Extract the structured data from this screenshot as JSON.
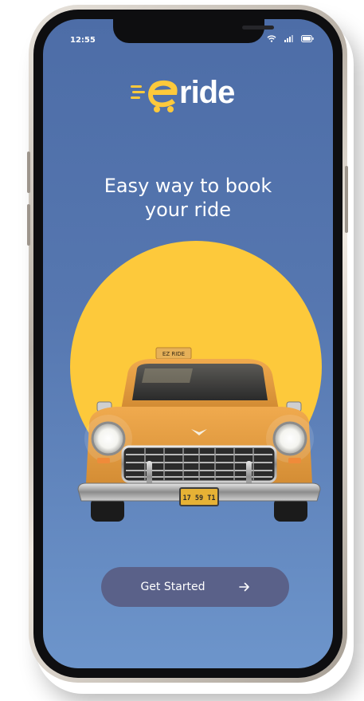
{
  "status_bar": {
    "time": "12:55",
    "icons": [
      "wifi-icon",
      "cellular-signal-icon",
      "battery-icon"
    ]
  },
  "logo": {
    "letter": "e",
    "word": "ride",
    "letter_color": "#fdc93b",
    "word_color": "#ffffff"
  },
  "headline": {
    "line1": "Easy way to book",
    "line2": "your ride"
  },
  "illustration": {
    "roof_sign": "EZ RIDE",
    "license_plate": "17 59 T1"
  },
  "cta": {
    "label": "Get Started",
    "icon": "arrow-right-icon"
  },
  "colors": {
    "accent_yellow": "#fdc93b",
    "screen_background": "#5677b0",
    "button_background": "#5a6189"
  }
}
